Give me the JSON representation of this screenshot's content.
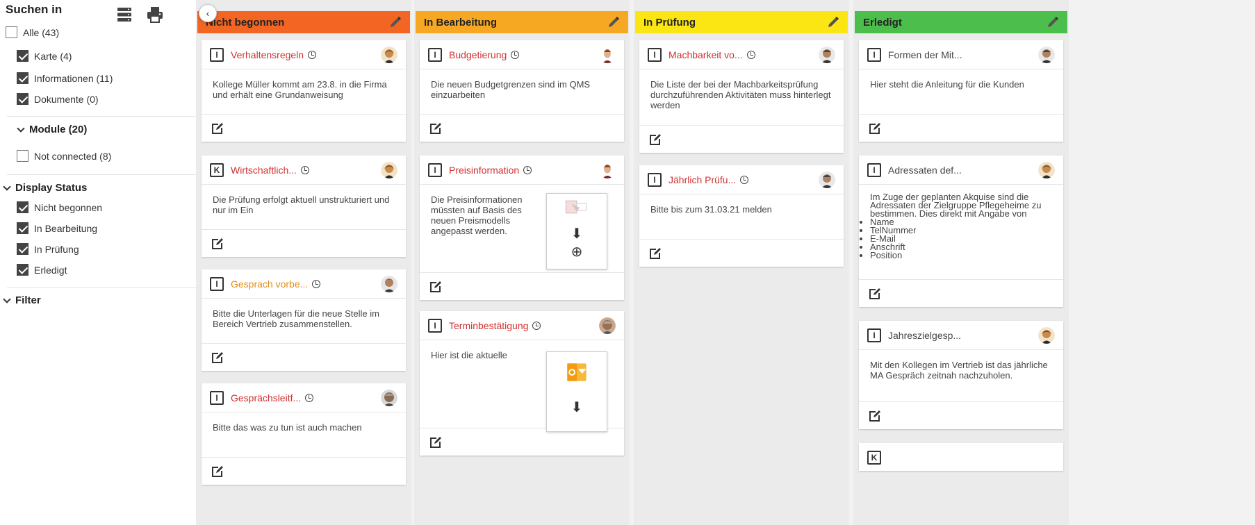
{
  "sidebar": {
    "title": "Suchen in",
    "all": {
      "label": "Alle (43)",
      "checked": false
    },
    "types": [
      {
        "label": "Karte (4)",
        "checked": true
      },
      {
        "label": "Informationen (11)",
        "checked": true
      },
      {
        "label": "Dokumente (0)",
        "checked": true
      }
    ],
    "modules_header": "Module (20)",
    "not_connected": {
      "label": "Not connected (8)",
      "checked": false
    },
    "display_status_header": "Display Status",
    "statuses": [
      {
        "label": "Nicht begonnen",
        "checked": true
      },
      {
        "label": "In Bearbeitung",
        "checked": true
      },
      {
        "label": "In Prüfung",
        "checked": true
      },
      {
        "label": "Erledigt",
        "checked": true
      }
    ],
    "filter_header": "Filter",
    "icons": [
      "layout-icon",
      "printer-icon",
      "chevron-left-icon"
    ]
  },
  "columns": [
    {
      "title": "Nicht begonnen",
      "color": "#f26522",
      "cards": [
        {
          "type": "I",
          "title": "Verhaltensregeln",
          "title_color": "red",
          "body": "Kollege Müller kommt am 23.8. in die Firma und erhält eine Grundanweisung"
        },
        {
          "type": "K",
          "title": "Wirtschaftlich...",
          "title_color": "red",
          "body": "Die Prüfung erfolgt aktuell unstrukturiert und nur im Ein"
        },
        {
          "type": "I",
          "title": "Gesprach vorbe...",
          "title_color": "orange",
          "body": "Bitte die Unterlagen für die neue Stelle im Bereich Vertrieb zusammenstellen."
        },
        {
          "type": "I",
          "title": "Gesprächsleitf...",
          "title_color": "red",
          "body": "Bitte das was zu tun ist auch machen"
        }
      ]
    },
    {
      "title": "In Bearbeitung",
      "color": "#f7a823",
      "cards": [
        {
          "type": "I",
          "title": "Budgetierung",
          "title_color": "red",
          "body": "Die neuen Budgetgrenzen sind im QMS einzuarbeiten"
        },
        {
          "type": "I",
          "title": "Preisinformation",
          "title_color": "red",
          "body": "Die Preisinformationen müssten auf Basis des neuen Preismodells angepasst werden."
        },
        {
          "type": "I",
          "title": "Terminbestätigung",
          "title_color": "red",
          "body": "Hier ist die aktuelle"
        }
      ]
    },
    {
      "title": "In Prüfung",
      "color": "#fbe613",
      "cards": [
        {
          "type": "I",
          "title": "Machbarkeit vo...",
          "title_color": "red",
          "body": "Die Liste der bei der Machbarkeitsprüfung durchzuführenden Aktivitäten muss hinterlegt werden"
        },
        {
          "type": "I",
          "title": "Jährlich Prüfu...",
          "title_color": "red",
          "body": "Bitte bis zum 31.03.21 melden"
        }
      ]
    },
    {
      "title": "Erledigt",
      "color": "#4cbe4c",
      "cards": [
        {
          "type": "I",
          "title": "Formen der Mit...",
          "title_color": "dark",
          "body": "Hier steht die Anleitung für die Kunden"
        },
        {
          "type": "I",
          "title": "Adressaten def...",
          "title_color": "dark",
          "body": "Im Zuge der geplanten Akquise sind die Adressaten der Zielgruppe Pflegeheime zu bestimmen. Dies direkt mit Angabe von",
          "list": [
            "Name",
            "TelNummer",
            "E-Mail",
            "Anschrift",
            "Position"
          ]
        },
        {
          "type": "I",
          "title": "Jahreszielgesp...",
          "title_color": "dark",
          "body": "Mit den Kollegen im Vertrieb ist das jährliche MA Gespräch zeitnah nachzuholen."
        },
        {
          "type": "K",
          "title": "",
          "title_color": "dark",
          "body": ""
        }
      ]
    }
  ]
}
